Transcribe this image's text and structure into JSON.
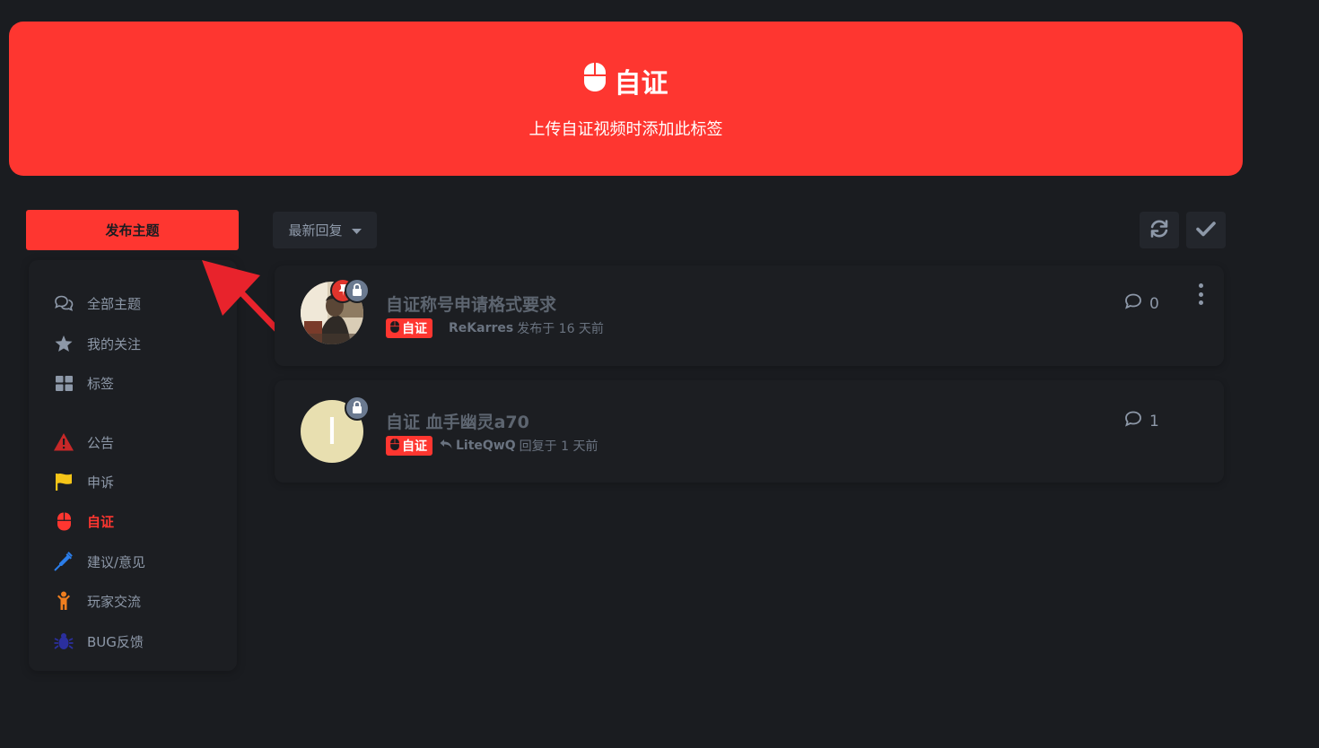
{
  "hero": {
    "title": "自证",
    "description": "上传自证视频时添加此标签",
    "icon": "mouse-icon"
  },
  "sidebar": {
    "post_button": "发布主题",
    "items": [
      {
        "label": "全部主题",
        "icon": "comments-icon"
      },
      {
        "label": "我的关注",
        "icon": "star-icon"
      },
      {
        "label": "标签",
        "icon": "grid-icon"
      },
      {
        "label": "公告",
        "icon": "warning-icon",
        "color": "#e0342c"
      },
      {
        "label": "申诉",
        "icon": "flag-icon",
        "color": "#f5c518"
      },
      {
        "label": "自证",
        "icon": "mouse-icon",
        "color": "#fe3630",
        "active": true
      },
      {
        "label": "建议/意见",
        "icon": "syringe-icon",
        "color": "#2b7de9"
      },
      {
        "label": "玩家交流",
        "icon": "child-icon",
        "color": "#f07e1e"
      },
      {
        "label": "BUG反馈",
        "icon": "bug-icon",
        "color": "#2b2f9e"
      }
    ]
  },
  "toolbar": {
    "sort_label": "最新回复",
    "refresh_icon": "refresh-icon",
    "mark_read_icon": "check-icon"
  },
  "discussions": [
    {
      "title": "自证称号申请格式要求",
      "tag": "自证",
      "user": "ReKarres",
      "action": "发布于 16 天前",
      "reply_count": "0",
      "pinned": true,
      "locked": true
    },
    {
      "title": "自证 血手幽灵a70",
      "tag": "自证",
      "user": "LiteQwQ",
      "action": "回复于 1 天前",
      "reply_count": "1",
      "pinned": false,
      "locked": true,
      "avatar_letter": "I"
    }
  ],
  "colors": {
    "accent": "#fe3630",
    "background": "#1a1c20",
    "lock_badge": "#6b7a90"
  }
}
